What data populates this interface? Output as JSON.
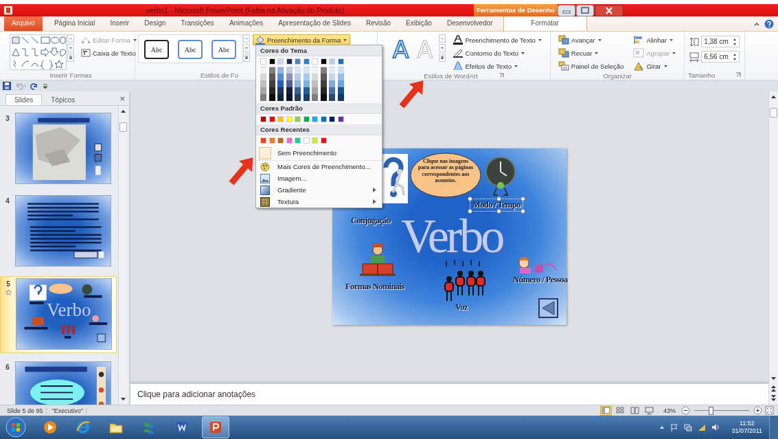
{
  "window": {
    "title": "verbo1 - Microsoft PowerPoint (Falha na Ativação do Produto)",
    "contextual_header": "Ferramentas de Desenho"
  },
  "tabs": [
    {
      "label": "Arquivo",
      "kind": "file",
      "selected": false
    },
    {
      "label": "Página Inicial",
      "kind": "normal",
      "selected": false
    },
    {
      "label": "Inserir",
      "kind": "normal",
      "selected": false
    },
    {
      "label": "Design",
      "kind": "normal",
      "selected": false
    },
    {
      "label": "Transições",
      "kind": "normal",
      "selected": false
    },
    {
      "label": "Animações",
      "kind": "normal",
      "selected": false
    },
    {
      "label": "Apresentação de Slides",
      "kind": "normal",
      "selected": false
    },
    {
      "label": "Revisão",
      "kind": "normal",
      "selected": false
    },
    {
      "label": "Exibição",
      "kind": "normal",
      "selected": false
    },
    {
      "label": "Desenvolvedor",
      "kind": "normal",
      "selected": false
    },
    {
      "label": "Formatar",
      "kind": "contextual",
      "selected": true
    }
  ],
  "ribbon": {
    "insert_shapes": {
      "commands": [
        {
          "label": "Editar Forma",
          "kind": "edit",
          "disabled": true
        },
        {
          "label": "Caixa de Texto",
          "kind": "textbox",
          "disabled": false
        }
      ],
      "group_label": "Inserir Formas"
    },
    "shape_styles": {
      "styles": [
        {
          "label": "Abc",
          "kind": "dark"
        },
        {
          "label": "Abc",
          "kind": "blue"
        },
        {
          "label": "Abc",
          "kind": "blue"
        }
      ],
      "shape_fill": {
        "label": "Preenchimento da Forma",
        "pressed": true
      },
      "group_label": "Estilos de Fo"
    },
    "wordart_styles": {
      "styles": [
        {
          "label": "A",
          "kind": "blue"
        },
        {
          "label": "A",
          "kind": "outline"
        }
      ],
      "commands": [
        {
          "label": "Preenchimento de Texto",
          "kind": "text-fill"
        },
        {
          "label": "Contorno do Texto",
          "kind": "text-outline"
        },
        {
          "label": "Efeitos de Texto",
          "kind": "text-effects"
        }
      ],
      "group_label": "Estilos de WordArt"
    },
    "arrange": {
      "commands": [
        {
          "label": "Avançar",
          "kind": "forward",
          "disabled": false
        },
        {
          "label": "Recuar",
          "kind": "backward",
          "disabled": false
        },
        {
          "label": "Painel de Seleção",
          "kind": "pane",
          "disabled": false
        },
        {
          "label": "Alinhar",
          "kind": "align",
          "disabled": false
        },
        {
          "label": "Agrupar",
          "kind": "group",
          "disabled": true
        },
        {
          "label": "Girar",
          "kind": "rotate",
          "disabled": false
        }
      ],
      "group_label": "Organizar"
    },
    "size": {
      "fields": [
        {
          "value": "1,38 cm",
          "kind": "height"
        },
        {
          "value": "6,56 cm",
          "kind": "width"
        }
      ],
      "group_label": "Tamanho"
    }
  },
  "fill_menu": {
    "theme_heading": "Cores do Tema",
    "theme_colors": [
      {
        "color": "#ffffff",
        "shades": [
          {
            "color": "#f2f2f2"
          },
          {
            "color": "#d9d9d9"
          },
          {
            "color": "#bfbfbf"
          },
          {
            "color": "#a6a6a6"
          },
          {
            "color": "#7f7f7f"
          }
        ]
      },
      {
        "color": "#000000",
        "shades": [
          {
            "color": "#7f7f7f"
          },
          {
            "color": "#595959"
          },
          {
            "color": "#404040"
          },
          {
            "color": "#262626"
          },
          {
            "color": "#0d0d0d"
          }
        ]
      },
      {
        "color": "#c6d9f1",
        "shades": [
          {
            "color": "#8db3e2"
          },
          {
            "color": "#548dd4"
          },
          {
            "color": "#1f5fbf"
          },
          {
            "color": "#17365d"
          },
          {
            "color": "#0f243e"
          }
        ]
      },
      {
        "color": "#1f2a4d",
        "shades": [
          {
            "color": "#c5c9dd"
          },
          {
            "color": "#8c93bb"
          },
          {
            "color": "#545d99"
          },
          {
            "color": "#171f3a"
          },
          {
            "color": "#0f1527"
          }
        ]
      },
      {
        "color": "#4f81bd",
        "shades": [
          {
            "color": "#dbe5f1"
          },
          {
            "color": "#b8cce4"
          },
          {
            "color": "#95b3d7"
          },
          {
            "color": "#366092"
          },
          {
            "color": "#244061"
          }
        ]
      },
      {
        "color": "#2a7fd4",
        "shades": [
          {
            "color": "#d3e5f7"
          },
          {
            "color": "#a7cbef"
          },
          {
            "color": "#7bb1e7"
          },
          {
            "color": "#1f5f9f"
          },
          {
            "color": "#153f6a"
          }
        ]
      },
      {
        "color": "#ffffff",
        "shades": [
          {
            "color": "#f2f2f2"
          },
          {
            "color": "#d9d9d9"
          },
          {
            "color": "#bfbfbf"
          },
          {
            "color": "#a6a6a6"
          },
          {
            "color": "#7f7f7f"
          }
        ]
      },
      {
        "color": "#000000",
        "shades": [
          {
            "color": "#7f7f7f"
          },
          {
            "color": "#595959"
          },
          {
            "color": "#404040"
          },
          {
            "color": "#262626"
          },
          {
            "color": "#0d0d0d"
          }
        ]
      },
      {
        "color": "#b8cce4",
        "shades": [
          {
            "color": "#e2eaf4"
          },
          {
            "color": "#c6d6e9"
          },
          {
            "color": "#8aa8cf"
          },
          {
            "color": "#4a6fa0"
          },
          {
            "color": "#2e4766"
          }
        ]
      },
      {
        "color": "#1f6fbf",
        "shades": [
          {
            "color": "#cde0f5"
          },
          {
            "color": "#9bc1eb"
          },
          {
            "color": "#6aa2e1"
          },
          {
            "color": "#17538f"
          },
          {
            "color": "#0f375f"
          }
        ]
      }
    ],
    "standard_heading": "Cores Padrão",
    "standard_colors": [
      {
        "color": "#c00000"
      },
      {
        "color": "#ff0000"
      },
      {
        "color": "#ffc000"
      },
      {
        "color": "#ffff00"
      },
      {
        "color": "#92d050"
      },
      {
        "color": "#00b050"
      },
      {
        "color": "#00b0f0"
      },
      {
        "color": "#0070c0"
      },
      {
        "color": "#002060"
      },
      {
        "color": "#7030a0"
      }
    ],
    "recent_heading": "Cores Recentes",
    "recent_colors": [
      {
        "color": "#ff4010"
      },
      {
        "color": "#f07820"
      },
      {
        "color": "#c0661a"
      },
      {
        "color": "#ff66cc"
      },
      {
        "color": "#22cc99"
      },
      {
        "color": "#ffffff"
      },
      {
        "color": "#ccee33"
      },
      {
        "color": "#ee1111"
      }
    ],
    "items": [
      {
        "label": "Sem Preenchimento",
        "kind": "none",
        "submenu": false
      },
      {
        "label": "Mais Cores de Preenchimento...",
        "kind": "more",
        "submenu": false
      },
      {
        "label": "Imagem...",
        "kind": "picture",
        "submenu": false
      },
      {
        "label": "Gradiente",
        "kind": "gradient",
        "submenu": true
      },
      {
        "label": "Textura",
        "kind": "texture",
        "submenu": true
      }
    ]
  },
  "slides_pane": {
    "tabs": [
      {
        "label": "Slides",
        "selected": true
      },
      {
        "label": "Tópicos",
        "selected": false
      }
    ],
    "close": "×",
    "thumbnails": [
      {
        "number": "3",
        "kind": "picture",
        "selected": false,
        "animated": false
      },
      {
        "number": "4",
        "kind": "text",
        "selected": false,
        "animated": false
      },
      {
        "number": "5",
        "kind": "menu",
        "selected": true,
        "animated": true,
        "title": "Verbo"
      },
      {
        "number": "6",
        "kind": "cloud",
        "selected": false,
        "animated": false
      }
    ]
  },
  "slide": {
    "callout": "Clique nas imagens para acessar as páginas correspondentes aos assuntos.",
    "title": "Verbo",
    "objects": [
      {
        "kind": "question",
        "label": "Conjugação",
        "selected": false
      },
      {
        "kind": "clock",
        "label": "Modo / Tempo",
        "selected": true
      },
      {
        "kind": "reader",
        "label": "Formas Nominais",
        "selected": false
      },
      {
        "kind": "singers",
        "label": "Voz",
        "selected": false
      },
      {
        "kind": "girl",
        "label": "Número / Pessoa",
        "selected": false
      }
    ]
  },
  "notes": {
    "placeholder": "Clique para adicionar anotações"
  },
  "status_bar": {
    "slide": "Slide 5 de 95",
    "theme": "\"Executivo\"",
    "views": [
      {
        "kind": "normal",
        "selected": true
      },
      {
        "kind": "sorter",
        "selected": false
      },
      {
        "kind": "reading",
        "selected": false
      },
      {
        "kind": "show",
        "selected": false
      }
    ],
    "zoom": "43%",
    "zoom_slider": {
      "level": 0.3
    }
  },
  "taskbar": {
    "apps": [
      {
        "kind": "media",
        "active": false
      },
      {
        "kind": "browser",
        "active": false
      },
      {
        "kind": "folder",
        "active": false
      },
      {
        "kind": "people",
        "active": false
      },
      {
        "kind": "word",
        "active": false
      },
      {
        "kind": "powerpoint",
        "active": true
      }
    ],
    "time": "11:52",
    "date": "31/07/2011"
  }
}
